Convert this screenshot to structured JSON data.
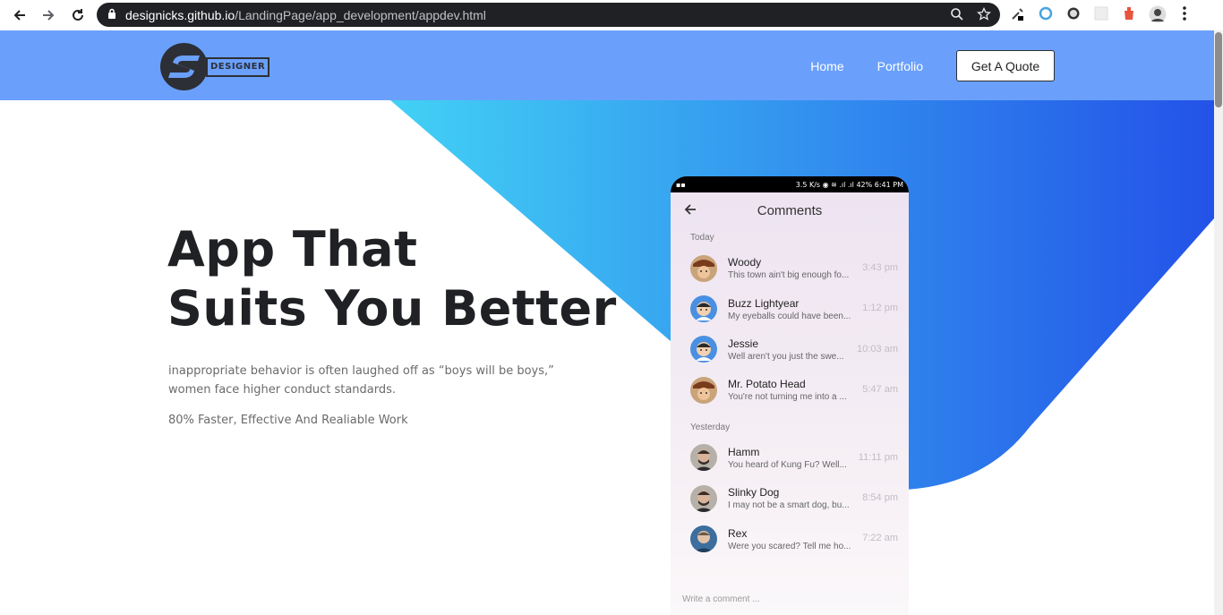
{
  "browser": {
    "url_host": "designicks.github.io",
    "url_path": "/LandingPage/app_development/appdev.html"
  },
  "header": {
    "logo_text": "DESIGNER",
    "nav": [
      {
        "label": "Home"
      },
      {
        "label": "Portfolio"
      }
    ],
    "cta_label": "Get A Quote"
  },
  "hero": {
    "title_line1": "App That",
    "title_line2": "Suits You Better",
    "description": "inappropriate behavior is often laughed off as “boys will be boys,” women face higher conduct standards.",
    "subtext": "80% Faster, Effective And Realiable Work",
    "colors": {
      "gradient_start": "#42d1f5",
      "gradient_end": "#2352e8",
      "header_bg": "#6aa0fb"
    }
  },
  "phone": {
    "status_left": "3.5 K/s",
    "status_right": "42% 6:41 PM",
    "screen_title": "Comments",
    "today_label": "Today",
    "yesterday_label": "Yesterday",
    "today": [
      {
        "name": "Woody",
        "body": "This town ain't big enough fo...",
        "time": "3:43 pm",
        "avatar": "woody"
      },
      {
        "name": "Buzz Lightyear",
        "body": "My eyeballs could have been...",
        "time": "1:12 pm",
        "avatar": "buzz"
      },
      {
        "name": "Jessie",
        "body": "Well aren't you just the swe...",
        "time": "10:03 am",
        "avatar": "buzz"
      },
      {
        "name": "Mr. Potato Head",
        "body": "You're not turning me into a ...",
        "time": "5:47 am",
        "avatar": "woody"
      }
    ],
    "yesterday": [
      {
        "name": "Hamm",
        "body": "You heard of Kung Fu? Well...",
        "time": "11:11 pm",
        "avatar": "man1"
      },
      {
        "name": "Slinky Dog",
        "body": "I may not be a smart dog, bu...",
        "time": "8:54 pm",
        "avatar": "man1"
      },
      {
        "name": "Rex",
        "body": "Were you scared? Tell me ho...",
        "time": "7:22 am",
        "avatar": "man2"
      }
    ],
    "write_placeholder": "Write a comment ..."
  }
}
